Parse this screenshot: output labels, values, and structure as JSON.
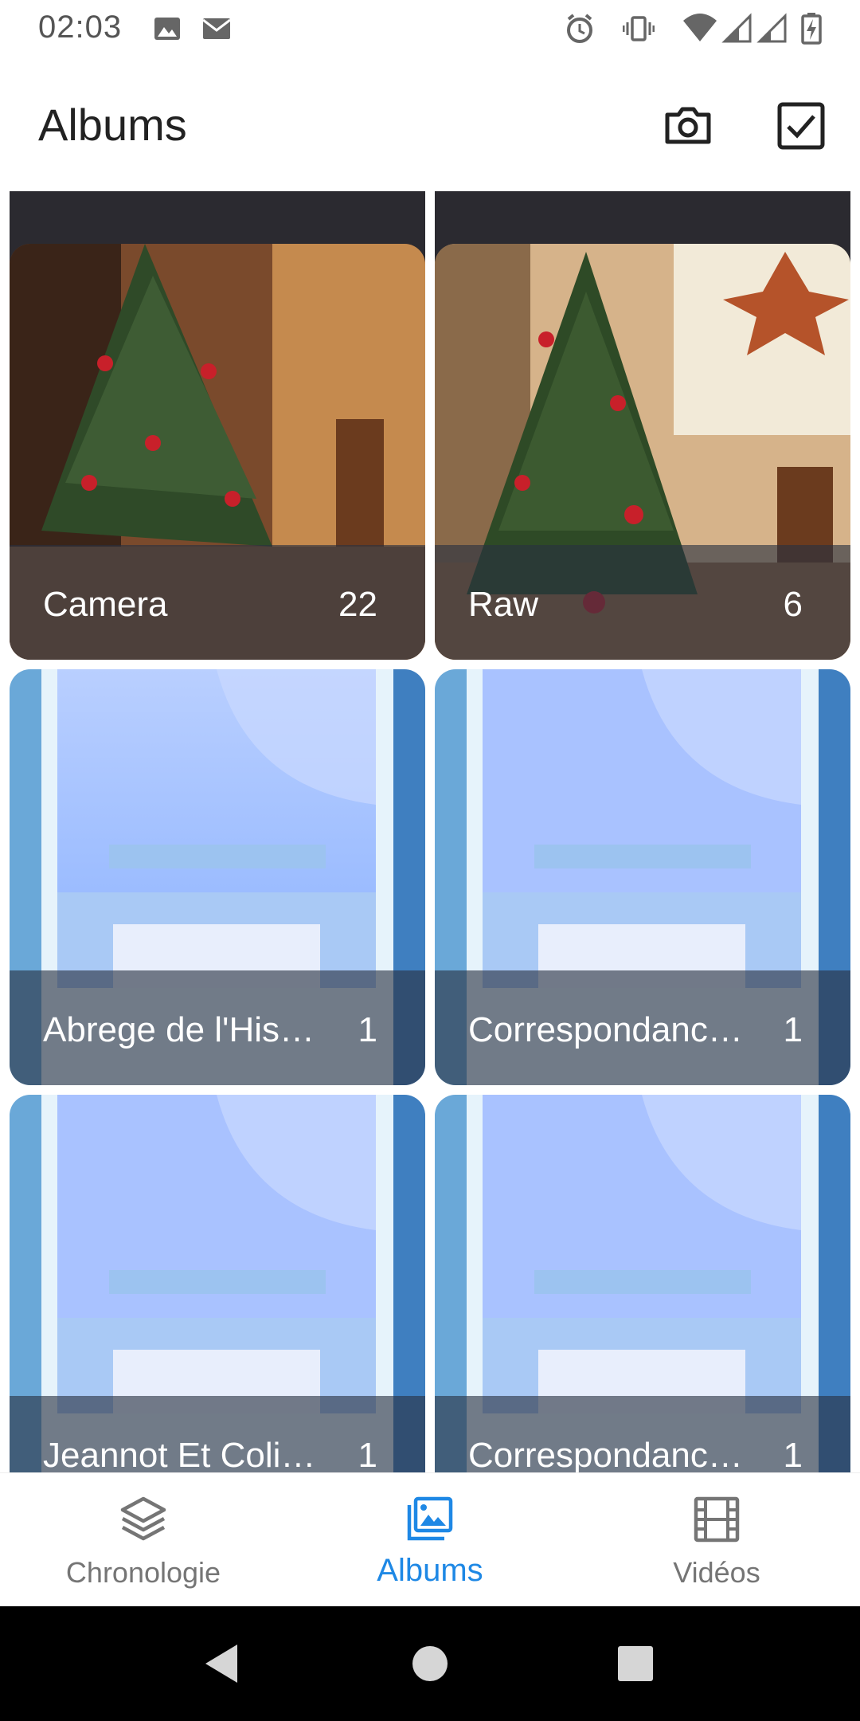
{
  "status_bar": {
    "time": "02:03",
    "left_icons": [
      "image-icon",
      "mail-icon"
    ],
    "right_icons": [
      "alarm-icon",
      "vibrate-icon",
      "wifi-icon",
      "signal-icon",
      "signal-icon",
      "battery-charging-icon"
    ]
  },
  "app_bar": {
    "title": "Albums",
    "actions": [
      "camera-icon",
      "select-checkbox-icon"
    ]
  },
  "albums": [
    {
      "name": "Camera",
      "count": "22"
    },
    {
      "name": "Raw",
      "count": "6"
    },
    {
      "name": "Abrege de l'His…",
      "count": "1"
    },
    {
      "name": "Correspondanc…",
      "count": "1"
    },
    {
      "name": "Jeannot Et Coli…",
      "count": "1"
    },
    {
      "name": "Correspondanc…",
      "count": "1"
    }
  ],
  "bottom_nav": {
    "items": [
      {
        "label": "Chronologie",
        "icon": "layers-icon",
        "active": false
      },
      {
        "label": "Albums",
        "icon": "photo-album-icon",
        "active": true
      },
      {
        "label": "Vidéos",
        "icon": "film-icon",
        "active": false
      }
    ]
  },
  "colors": {
    "accent": "#1e88e5",
    "caption_overlay": "#283040",
    "inactive": "#757575"
  }
}
